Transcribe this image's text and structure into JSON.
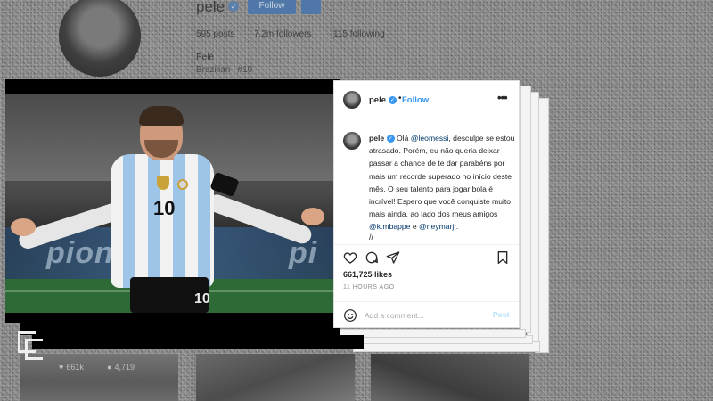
{
  "background_profile": {
    "username": "pele",
    "follow_label": "Follow",
    "stats": {
      "posts": "595 posts",
      "followers": "7.2m followers",
      "following": "115 following"
    },
    "display_name": "Pelé",
    "bio": "Brazilian | #10",
    "grid_stats": {
      "likes": "661k",
      "comments": "4,719"
    }
  },
  "photo": {
    "board_text": "pion",
    "board_text_2": "pi",
    "jersey_number": "10",
    "shorts_number": "10"
  },
  "post": {
    "username": "pele",
    "separator": "•",
    "follow_label": "Follow",
    "more_label": "•••",
    "caption": {
      "username": "pele",
      "text_1": "Olá ",
      "mention_1": "@leomessi",
      "text_2": ", desculpe se estou atrasado. Porém, eu não queria deixar passar a chance de te dar parabéns por mais um recorde superado no início deste mês. O seu talento para jogar bola é incrível! Espero que você conquiste muito mais ainda, ao lado dos meus amigos ",
      "mention_2": "@k.mbappe",
      "text_3": " e ",
      "mention_3": "@neymarjr",
      "text_4": "."
    },
    "ellipsis": "//",
    "likes": "661,725 likes",
    "time_ago": "11 HOURS AGO",
    "comment_placeholder": "Add a comment...",
    "post_label": "Post"
  },
  "colors": {
    "accent": "#3897f0",
    "post_button_disabled": "#b2dffc",
    "text": "#262626",
    "muted": "#8e8e8e"
  },
  "icons": [
    "heart-icon",
    "comment-icon",
    "share-icon",
    "bookmark-icon",
    "smile-icon",
    "verified-icon"
  ]
}
